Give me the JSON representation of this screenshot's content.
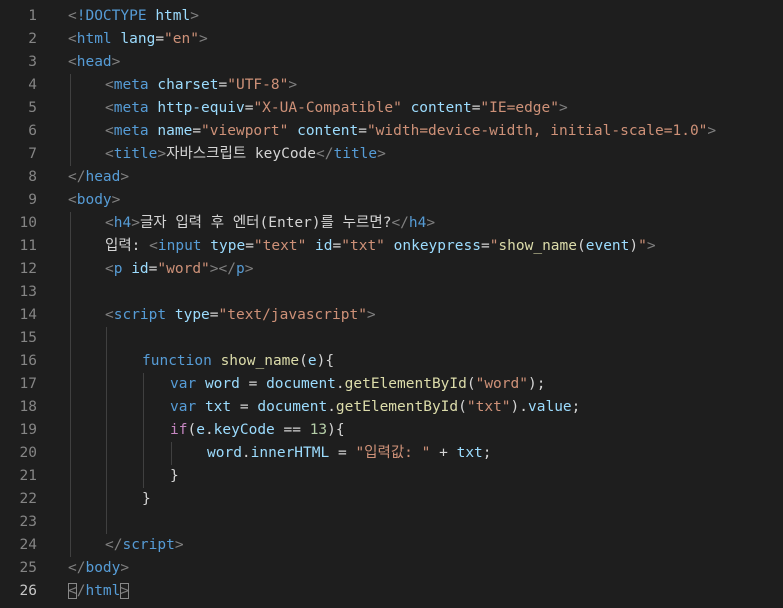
{
  "editor": {
    "active_line": 26,
    "colors": {
      "background": "#1e1e1e",
      "tag": "#569cd6",
      "bracket": "#808080",
      "attribute": "#9cdcfe",
      "string": "#ce9178",
      "text": "#d4d4d4",
      "keyword": "#569cd6",
      "control": "#c586c0",
      "function": "#dcdcaa",
      "number": "#b5cea8",
      "line_number": "#858585",
      "line_number_active": "#c6c6c6"
    },
    "lines": [
      {
        "n": "1",
        "indent": 0,
        "tokens": [
          [
            "br",
            "<"
          ],
          [
            "tag",
            "!DOCTYPE"
          ],
          [
            "text",
            " "
          ],
          [
            "attr",
            "html"
          ],
          [
            "br",
            ">"
          ]
        ]
      },
      {
        "n": "2",
        "indent": 0,
        "tokens": [
          [
            "br",
            "<"
          ],
          [
            "tag",
            "html"
          ],
          [
            "text",
            " "
          ],
          [
            "attr",
            "lang"
          ],
          [
            "text",
            "="
          ],
          [
            "str",
            "\"en\""
          ],
          [
            "br",
            ">"
          ]
        ]
      },
      {
        "n": "3",
        "indent": 0,
        "tokens": [
          [
            "br",
            "<"
          ],
          [
            "tag",
            "head"
          ],
          [
            "br",
            ">"
          ]
        ]
      },
      {
        "n": "4",
        "indent": 1,
        "tokens": [
          [
            "br",
            "<"
          ],
          [
            "tag",
            "meta"
          ],
          [
            "text",
            " "
          ],
          [
            "attr",
            "charset"
          ],
          [
            "text",
            "="
          ],
          [
            "str",
            "\"UTF-8\""
          ],
          [
            "br",
            ">"
          ]
        ]
      },
      {
        "n": "5",
        "indent": 1,
        "tokens": [
          [
            "br",
            "<"
          ],
          [
            "tag",
            "meta"
          ],
          [
            "text",
            " "
          ],
          [
            "attr",
            "http-equiv"
          ],
          [
            "text",
            "="
          ],
          [
            "str",
            "\"X-UA-Compatible\""
          ],
          [
            "text",
            " "
          ],
          [
            "attr",
            "content"
          ],
          [
            "text",
            "="
          ],
          [
            "str",
            "\"IE=edge\""
          ],
          [
            "br",
            ">"
          ]
        ]
      },
      {
        "n": "6",
        "indent": 1,
        "tokens": [
          [
            "br",
            "<"
          ],
          [
            "tag",
            "meta"
          ],
          [
            "text",
            " "
          ],
          [
            "attr",
            "name"
          ],
          [
            "text",
            "="
          ],
          [
            "str",
            "\"viewport\""
          ],
          [
            "text",
            " "
          ],
          [
            "attr",
            "content"
          ],
          [
            "text",
            "="
          ],
          [
            "str",
            "\"width=device-width, initial-scale=1.0\""
          ],
          [
            "br",
            ">"
          ]
        ]
      },
      {
        "n": "7",
        "indent": 1,
        "tokens": [
          [
            "br",
            "<"
          ],
          [
            "tag",
            "title"
          ],
          [
            "br",
            ">"
          ],
          [
            "text",
            "자바스크립트 keyCode"
          ],
          [
            "br",
            "</"
          ],
          [
            "tag",
            "title"
          ],
          [
            "br",
            ">"
          ]
        ]
      },
      {
        "n": "8",
        "indent": 0,
        "tokens": [
          [
            "br",
            "</"
          ],
          [
            "tag",
            "head"
          ],
          [
            "br",
            ">"
          ]
        ]
      },
      {
        "n": "9",
        "indent": 0,
        "tokens": [
          [
            "br",
            "<"
          ],
          [
            "tag",
            "body"
          ],
          [
            "br",
            ">"
          ]
        ]
      },
      {
        "n": "10",
        "indent": 1,
        "tokens": [
          [
            "br",
            "<"
          ],
          [
            "tag",
            "h4"
          ],
          [
            "br",
            ">"
          ],
          [
            "text",
            "글자 입력 후 엔터(Enter)를 누르면?"
          ],
          [
            "br",
            "</"
          ],
          [
            "tag",
            "h4"
          ],
          [
            "br",
            ">"
          ]
        ]
      },
      {
        "n": "11",
        "indent": 1,
        "tokens": [
          [
            "text",
            "입력: "
          ],
          [
            "br",
            "<"
          ],
          [
            "tag",
            "input"
          ],
          [
            "text",
            " "
          ],
          [
            "attr",
            "type"
          ],
          [
            "text",
            "="
          ],
          [
            "str",
            "\"text\""
          ],
          [
            "text",
            " "
          ],
          [
            "attr",
            "id"
          ],
          [
            "text",
            "="
          ],
          [
            "str",
            "\"txt\""
          ],
          [
            "text",
            " "
          ],
          [
            "attr",
            "onkeypress"
          ],
          [
            "text",
            "="
          ],
          [
            "str",
            "\""
          ],
          [
            "fn",
            "show_name"
          ],
          [
            "punc",
            "("
          ],
          [
            "var",
            "event"
          ],
          [
            "punc",
            ")"
          ],
          [
            "str",
            "\""
          ],
          [
            "br",
            ">"
          ]
        ]
      },
      {
        "n": "12",
        "indent": 1,
        "tokens": [
          [
            "br",
            "<"
          ],
          [
            "tag",
            "p"
          ],
          [
            "text",
            " "
          ],
          [
            "attr",
            "id"
          ],
          [
            "text",
            "="
          ],
          [
            "str",
            "\"word\""
          ],
          [
            "br",
            "></"
          ],
          [
            "tag",
            "p"
          ],
          [
            "br",
            ">"
          ]
        ]
      },
      {
        "n": "13",
        "indent": 0,
        "tokens": []
      },
      {
        "n": "14",
        "indent": 1,
        "tokens": [
          [
            "br",
            "<"
          ],
          [
            "tag",
            "script"
          ],
          [
            "text",
            " "
          ],
          [
            "attr",
            "type"
          ],
          [
            "text",
            "="
          ],
          [
            "str",
            "\"text/javascript\""
          ],
          [
            "br",
            ">"
          ]
        ]
      },
      {
        "n": "15",
        "indent": 0,
        "tokens": []
      },
      {
        "n": "16",
        "indent": 2,
        "tokens": [
          [
            "kw",
            "function"
          ],
          [
            "text",
            " "
          ],
          [
            "fn",
            "show_name"
          ],
          [
            "punc",
            "("
          ],
          [
            "var",
            "e"
          ],
          [
            "punc",
            "){"
          ]
        ]
      },
      {
        "n": "17",
        "indent": 2,
        "extra": 28,
        "tokens": [
          [
            "kw",
            "var"
          ],
          [
            "text",
            " "
          ],
          [
            "var",
            "word"
          ],
          [
            "op",
            " = "
          ],
          [
            "var",
            "document"
          ],
          [
            "punc",
            "."
          ],
          [
            "fn",
            "getElementById"
          ],
          [
            "punc",
            "("
          ],
          [
            "str",
            "\"word\""
          ],
          [
            "punc",
            ");"
          ]
        ]
      },
      {
        "n": "18",
        "indent": 2,
        "extra": 28,
        "tokens": [
          [
            "kw",
            "var"
          ],
          [
            "text",
            " "
          ],
          [
            "var",
            "txt"
          ],
          [
            "op",
            " = "
          ],
          [
            "var",
            "document"
          ],
          [
            "punc",
            "."
          ],
          [
            "fn",
            "getElementById"
          ],
          [
            "punc",
            "("
          ],
          [
            "str",
            "\"txt\""
          ],
          [
            "punc",
            ")."
          ],
          [
            "var",
            "value"
          ],
          [
            "punc",
            ";"
          ]
        ]
      },
      {
        "n": "19",
        "indent": 2,
        "extra": 28,
        "tokens": [
          [
            "ctrl",
            "if"
          ],
          [
            "punc",
            "("
          ],
          [
            "var",
            "e"
          ],
          [
            "punc",
            "."
          ],
          [
            "var",
            "keyCode"
          ],
          [
            "op",
            " == "
          ],
          [
            "num",
            "13"
          ],
          [
            "punc",
            "){"
          ]
        ]
      },
      {
        "n": "20",
        "indent": 2,
        "extra": 65,
        "tokens": [
          [
            "var",
            "word"
          ],
          [
            "punc",
            "."
          ],
          [
            "var",
            "innerHTML"
          ],
          [
            "op",
            " = "
          ],
          [
            "str",
            "\"입력값: \""
          ],
          [
            "op",
            " + "
          ],
          [
            "var",
            "txt"
          ],
          [
            "punc",
            ";"
          ]
        ]
      },
      {
        "n": "21",
        "indent": 2,
        "extra": 28,
        "tokens": [
          [
            "punc",
            "}"
          ]
        ]
      },
      {
        "n": "22",
        "indent": 2,
        "tokens": [
          [
            "punc",
            "}"
          ]
        ]
      },
      {
        "n": "23",
        "indent": 0,
        "tokens": []
      },
      {
        "n": "24",
        "indent": 1,
        "tokens": [
          [
            "br",
            "</"
          ],
          [
            "tag",
            "script"
          ],
          [
            "br",
            ">"
          ]
        ]
      },
      {
        "n": "25",
        "indent": 0,
        "tokens": [
          [
            "br",
            "</"
          ],
          [
            "tag",
            "body"
          ],
          [
            "br",
            ">"
          ]
        ]
      },
      {
        "n": "26",
        "indent": 0,
        "tokens": [
          [
            "br",
            "<",
            "match"
          ],
          [
            "br",
            "/"
          ],
          [
            "tag",
            "html"
          ],
          [
            "br",
            ">",
            "match"
          ]
        ]
      }
    ]
  }
}
